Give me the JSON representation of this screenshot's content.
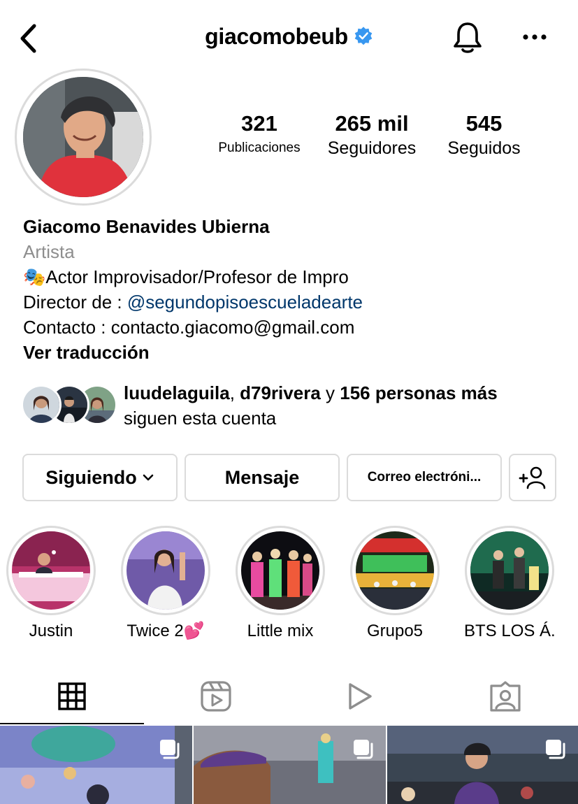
{
  "header": {
    "username": "giacomobeub",
    "back_icon": "chevron-left-icon",
    "bell_icon": "bell-icon",
    "more_icon": "more-horizontal-icon",
    "verified_color": "#3897f0"
  },
  "stats": {
    "posts": {
      "value": "321",
      "label": "Publicaciones"
    },
    "followers": {
      "value": "265 mil",
      "label": "Seguidores"
    },
    "following": {
      "value": "545",
      "label": "Seguidos"
    }
  },
  "bio": {
    "full_name": "Giacomo Benavides Ubierna",
    "category": "Artista",
    "line1_emoji": "🎭",
    "line1": "Actor Improvisador/Profesor de Impro",
    "line2_prefix": "Director de : ",
    "line2_link": "@segundopisoescueladearte",
    "line3": "Contacto : contacto.giacomo@gmail.com",
    "translate": "Ver traducción",
    "link_color": "#00376b"
  },
  "followed_by": {
    "user1": "luudelaguila",
    "separator": ", ",
    "user2": "d79rivera",
    "connector": " y ",
    "others": "156 personas más",
    "suffix": "siguen esta cuenta"
  },
  "actions": {
    "following": "Siguiendo",
    "message": "Mensaje",
    "email": "Correo electróni...",
    "add_user_icon": "add-user-icon"
  },
  "highlights": [
    {
      "label": "Justin"
    },
    {
      "label": "Twice 2💕"
    },
    {
      "label": "Little mix"
    },
    {
      "label": "Grupo5"
    },
    {
      "label": "BTS LOS Á..."
    }
  ],
  "tabs": [
    {
      "icon": "grid-icon",
      "active": true
    },
    {
      "icon": "reels-icon",
      "active": false
    },
    {
      "icon": "play-icon",
      "active": false
    },
    {
      "icon": "tagged-icon",
      "active": false
    }
  ]
}
